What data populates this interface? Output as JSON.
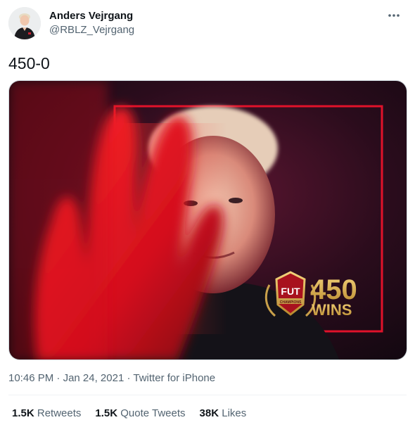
{
  "author": {
    "display_name": "Anders Vejrgang",
    "handle": "@RBLZ_Vejrgang"
  },
  "tweet": {
    "text": "450-0"
  },
  "media": {
    "badge_top": "FUT",
    "badge_ribbon": "CHAMPIONS",
    "headline_number": "450",
    "headline_word": "WINS"
  },
  "meta": {
    "time": "10:46 PM",
    "separator": "·",
    "date": "Jan 24, 2021",
    "source": "Twitter for iPhone"
  },
  "stats": {
    "retweets_count": "1.5K",
    "retweets_label": "Retweets",
    "quotes_count": "1.5K",
    "quotes_label": "Quote Tweets",
    "likes_count": "38K",
    "likes_label": "Likes"
  },
  "colors": {
    "text_primary": "#0f1419",
    "text_secondary": "#536471",
    "accent_red": "#e0122a",
    "gold": "#d9a94a"
  }
}
